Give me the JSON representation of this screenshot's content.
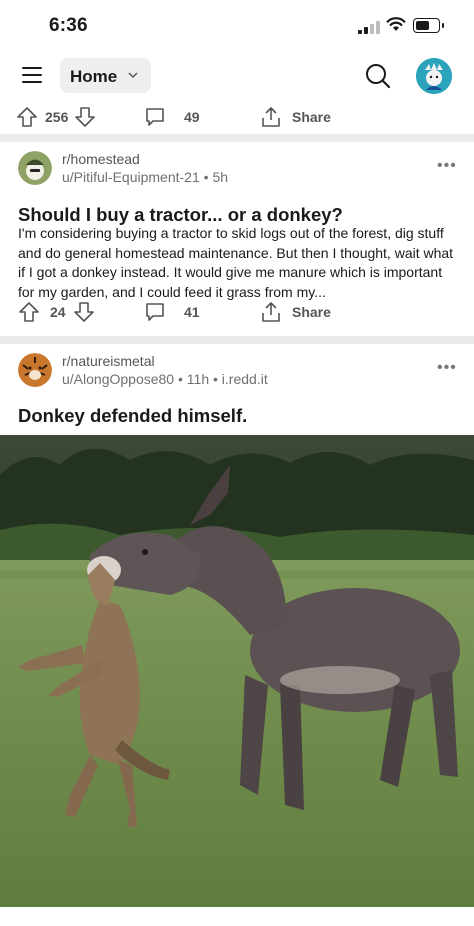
{
  "status_bar": {
    "time": "6:36"
  },
  "nav": {
    "feed_label": "Home"
  },
  "top_actions": {
    "upvotes": "256",
    "comments": "49",
    "share": "Share"
  },
  "posts": [
    {
      "subreddit": "r/homestead",
      "user": "u/Pitiful-Equipment-21",
      "age": "5h",
      "title": "Should I buy a tractor... or a donkey?",
      "body": "I'm considering buying a tractor to skid logs out of the forest, dig stuff and do general homestead maintenance. But then I thought, wait what if I got a donkey instead. It would give me manure which is important for my garden, and I could feed it grass from my...",
      "upvotes": "24",
      "comments": "41",
      "share": "Share"
    },
    {
      "subreddit": "r/natureismetal",
      "user": "u/AlongOppose80",
      "age": "11h",
      "domain": "i.redd.it",
      "title": "Donkey defended himself."
    }
  ],
  "icons": [
    "menu-icon",
    "chevron-down-icon",
    "search-icon",
    "upvote-icon",
    "downvote-icon",
    "comment-icon",
    "share-icon",
    "more-icon"
  ],
  "colors": {
    "background": "#ffffff",
    "divider": "#eaeaec",
    "meta_text": "#707070",
    "home_pill": "#efefef"
  }
}
